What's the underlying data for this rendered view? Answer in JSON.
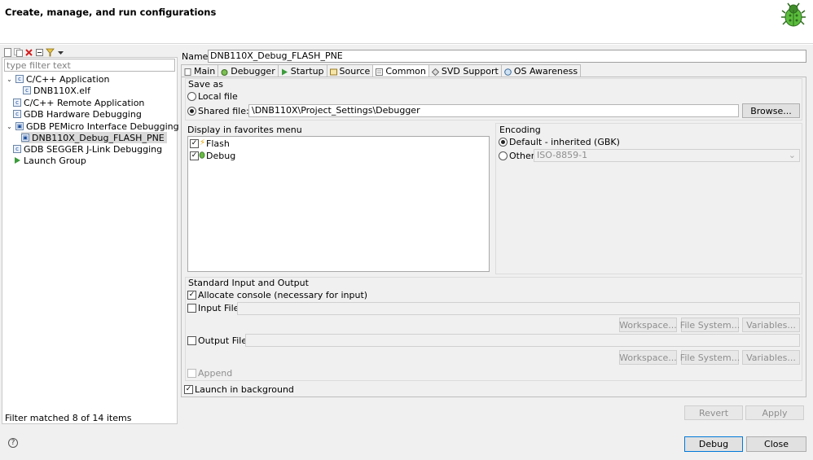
{
  "header": {
    "title": "Create, manage, and run configurations",
    "icon": "bug-icon"
  },
  "left": {
    "toolbar_icons": [
      "new-config-icon",
      "duplicate-icon",
      "delete-icon",
      "collapse-all-icon",
      "filter-icon",
      "view-menu-icon"
    ],
    "filter_placeholder": "type filter text",
    "tree": [
      {
        "label": "C/C++ Application",
        "expanded": true,
        "level": 0,
        "icon": "c-icon"
      },
      {
        "label": "DNB110X.elf",
        "level": 1,
        "icon": "c-icon"
      },
      {
        "label": "C/C++ Remote Application",
        "level": 0,
        "icon": "c-icon"
      },
      {
        "label": "GDB Hardware Debugging",
        "level": 0,
        "icon": "c-icon"
      },
      {
        "label": "GDB PEMicro Interface Debugging",
        "expanded": true,
        "level": 0,
        "icon": "pemicro-icon"
      },
      {
        "label": "DNB110X_Debug_FLASH_PNE",
        "level": 1,
        "icon": "pemicro-icon",
        "selected": true
      },
      {
        "label": "GDB SEGGER J-Link Debugging",
        "level": 0,
        "icon": "c-icon"
      },
      {
        "label": "Launch Group",
        "level": 0,
        "icon": "launch-icon"
      }
    ],
    "status": "Filter matched 8 of 14 items"
  },
  "config": {
    "name_label": "Name:",
    "name_value": "DNB110X_Debug_FLASH_PNE",
    "tabs": [
      {
        "label": "Main",
        "icon": "main-tab-icon"
      },
      {
        "label": "Debugger",
        "icon": "debugger-tab-icon"
      },
      {
        "label": "Startup",
        "icon": "startup-tab-icon"
      },
      {
        "label": "Source",
        "icon": "source-tab-icon"
      },
      {
        "label": "Common",
        "icon": "common-tab-icon",
        "active": true
      },
      {
        "label": "SVD Support",
        "icon": "svd-tab-icon"
      },
      {
        "label": "OS Awareness",
        "icon": "os-tab-icon"
      }
    ],
    "save_as": {
      "title": "Save as",
      "local_label": "Local file",
      "shared_label": "Shared file:",
      "shared_value": "\\DNB110X\\Project_Settings\\Debugger",
      "browse_label": "Browse..."
    },
    "favorites": {
      "title": "Display in favorites menu",
      "items": [
        {
          "label": "Flash",
          "checked": true
        },
        {
          "label": "Debug",
          "checked": true
        }
      ]
    },
    "encoding": {
      "title": "Encoding",
      "default_label": "Default - inherited (GBK)",
      "other_label": "Other",
      "other_value": "ISO-8859-1"
    },
    "std_io": {
      "title": "Standard Input and Output",
      "allocate_label": "Allocate console (necessary for input)",
      "input_label": "Input File:",
      "output_label": "Output File:",
      "workspace_label": "Workspace...",
      "filesystem_label": "File System...",
      "variables_label": "Variables...",
      "append_label": "Append"
    },
    "launch_bg_label": "Launch in background",
    "revert_label": "Revert",
    "apply_label": "Apply"
  },
  "footer": {
    "debug_label": "Debug",
    "close_label": "Close",
    "help_glyph": "?"
  }
}
